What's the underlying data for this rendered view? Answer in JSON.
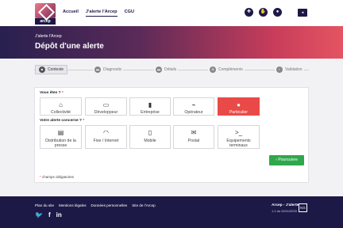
{
  "header": {
    "logo_text": "arcep",
    "nav": [
      "Accueil",
      "J'alerte l'Arcep",
      "CGU"
    ],
    "lang_label": "FR"
  },
  "hero": {
    "breadcrumb": "J'alerte l'Arcep",
    "title": "Dépôt d'une alerte"
  },
  "stepper": [
    {
      "label": "Contexte",
      "icon": "briefcase-icon",
      "active": true
    },
    {
      "label": "Diagnostic",
      "icon": "chat-icon",
      "active": false
    },
    {
      "label": "Détails",
      "icon": "folder-icon",
      "active": false
    },
    {
      "label": "Compléments",
      "icon": "attach-icon",
      "active": false
    },
    {
      "label": "Validation",
      "icon": "check-icon",
      "active": false
    }
  ],
  "form": {
    "q1": "Vous êtes ?",
    "q2": "Votre alerte concerne ?",
    "required_mark": "*",
    "who": [
      {
        "label": "Collectivité",
        "icon": "institution-icon"
      },
      {
        "label": "Développeur",
        "icon": "laptop-icon"
      },
      {
        "label": "Entreprise",
        "icon": "building-icon"
      },
      {
        "label": "Opérateur",
        "icon": "antenna-icon"
      },
      {
        "label": "Particulier",
        "icon": "person-icon",
        "selected": true
      }
    ],
    "topic": [
      {
        "label": "Distribution de la presse",
        "icon": "newspaper-icon"
      },
      {
        "label": "Fixe / Internet",
        "icon": "wifi-icon"
      },
      {
        "label": "Mobile",
        "icon": "mobile-icon"
      },
      {
        "label": "Postal",
        "icon": "envelope-icon"
      },
      {
        "label": "Equipements terminaux",
        "icon": "terminal-icon"
      }
    ],
    "submit_label": "Poursuivre",
    "required_note": "champs obligatoires"
  },
  "footer": {
    "links": [
      "Plan du site",
      "Mentions légales",
      "Données personnelles",
      "Site de l'Arcep"
    ],
    "social": [
      "twitter-icon",
      "facebook-icon",
      "linkedin-icon"
    ],
    "app_name": "Arcep - J'alerte",
    "version": "1.1 du 02/11/2020",
    "badge": "KG"
  },
  "colors": {
    "brand": "#1d1947",
    "accent": "#e94a48",
    "submit": "#2ea84a"
  }
}
